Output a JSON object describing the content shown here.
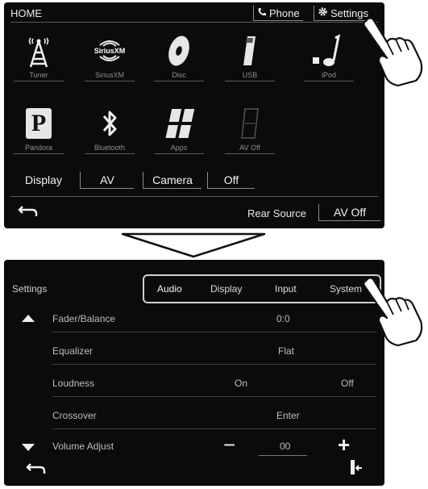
{
  "home": {
    "title": "HOME",
    "phone_label": "Phone",
    "settings_label": "Settings",
    "sources": [
      {
        "label": "Tuner",
        "icon": "antenna-tower-icon"
      },
      {
        "label": "SiriusXM",
        "icon": "siriusxm-logo-icon",
        "logo_text": "SiriusXM"
      },
      {
        "label": "Disc",
        "icon": "disc-icon"
      },
      {
        "label": "USB",
        "icon": "usb-icon"
      },
      {
        "label": "iPod",
        "icon": "music-note-icon"
      },
      {
        "label": "Pandora",
        "icon": "pandora-logo-icon"
      },
      {
        "label": "Bluetooth",
        "icon": "bluetooth-icon"
      },
      {
        "label": "Apps",
        "icon": "apps-grid-icon"
      },
      {
        "label": "AV Off",
        "icon": "av-off-icon"
      }
    ],
    "bottom_buttons": {
      "display": "Display",
      "av": "AV",
      "camera": "Camera",
      "off": "Off"
    },
    "rear_source_label": "Rear Source",
    "rear_source_value": "AV Off"
  },
  "settings": {
    "title": "Settings",
    "tabs": [
      "Audio",
      "Display",
      "Input",
      "System"
    ],
    "rows": [
      {
        "name": "Fader/Balance",
        "value": "0:0"
      },
      {
        "name": "Equalizer",
        "value": "Flat"
      },
      {
        "name": "Loudness",
        "value_on": "On",
        "value_off": "Off"
      },
      {
        "name": "Crossover",
        "value": "Enter"
      },
      {
        "name": "Volume Adjust",
        "value": "00",
        "minus": "−",
        "plus": "+"
      }
    ]
  },
  "colors": {
    "screen_bg": "#0b0b0b",
    "text": "#f2f2f2",
    "dim_text": "#bdbdbd"
  }
}
